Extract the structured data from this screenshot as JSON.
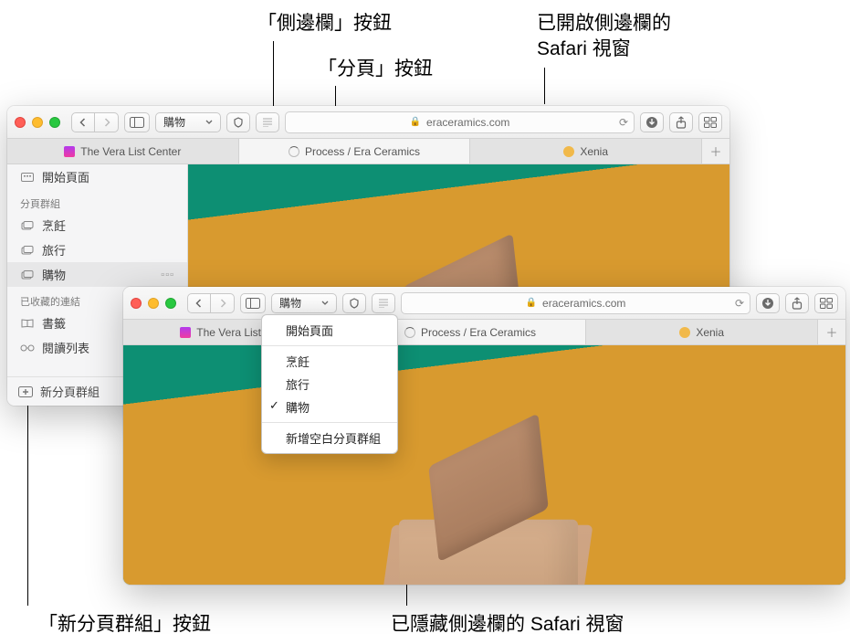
{
  "callouts": {
    "sidebar_btn": "「側邊欄」按鈕",
    "tabs_btn": "「分頁」按鈕",
    "window_sidebar_open_l1": "已開啟側邊欄的",
    "window_sidebar_open_l2": "Safari 視窗",
    "new_tabgroup_btn": "「新分頁群組」按鈕",
    "window_sidebar_hidden": "已隱藏側邊欄的 Safari 視窗"
  },
  "url_domain": "eraceramics.com",
  "tabgroup_selected": "購物",
  "tabs": [
    {
      "label": "The Vera List Center",
      "favicon": "#b23aee"
    },
    {
      "label": "Process / Era Ceramics",
      "favicon": "#c79a6b",
      "active": true,
      "loading": true
    },
    {
      "label": "Xenia",
      "favicon": "#f1b94a"
    }
  ],
  "sidebar": {
    "start_page": "開始頁面",
    "heading_groups": "分頁群組",
    "groups": [
      "烹飪",
      "旅行",
      "購物"
    ],
    "heading_saved": "已收藏的連結",
    "bookmarks": "書籤",
    "reading_list": "閱讀列表",
    "footer_new_group": "新分頁群組"
  },
  "menu": {
    "start_page": "開始頁面",
    "items": [
      "烹飪",
      "旅行",
      "購物"
    ],
    "checked": "購物",
    "new_empty_group": "新增空白分頁群組"
  }
}
